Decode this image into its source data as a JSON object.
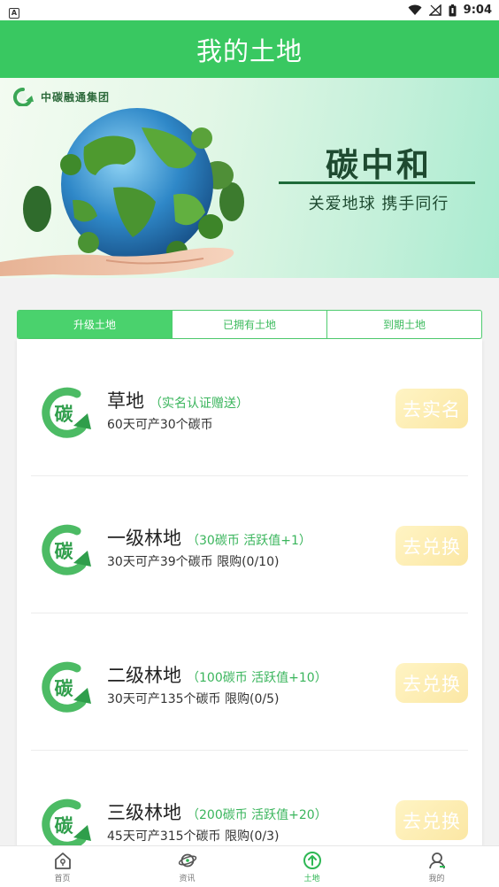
{
  "status_bar": {
    "sim_icon": "A",
    "time": "9:04",
    "icons": [
      "wifi-icon",
      "signal-icon",
      "battery-icon"
    ]
  },
  "header": {
    "title": "我的土地"
  },
  "banner": {
    "brand_name": "中碳融通集团",
    "title": "碳中和",
    "slogan": "关爱地球  携手同行"
  },
  "tabs": [
    {
      "label": "升级土地",
      "active": true
    },
    {
      "label": "已拥有土地",
      "active": false
    },
    {
      "label": "到期土地",
      "active": false
    }
  ],
  "logo_char": "碳",
  "lands": [
    {
      "name": "草地",
      "note": "（实名认证赠送）",
      "desc": "60天可产30个碳币",
      "button": "去实名"
    },
    {
      "name": "一级林地",
      "note": "（30碳币 活跃值+1）",
      "desc": "30天可产39个碳币 限购(0/10)",
      "button": "去兑换"
    },
    {
      "name": "二级林地",
      "note": "（100碳币 活跃值+10）",
      "desc": "30天可产135个碳币 限购(0/5)",
      "button": "去兑换"
    },
    {
      "name": "三级林地",
      "note": "（200碳币 活跃值+20）",
      "desc": "45天可产315个碳币 限购(0/3)",
      "button": "去兑换"
    }
  ],
  "nav": [
    {
      "label": "首页",
      "icon": "home-icon",
      "active": false
    },
    {
      "label": "资讯",
      "icon": "planet-icon",
      "active": false
    },
    {
      "label": "土地",
      "icon": "upload-circle-icon",
      "active": true
    },
    {
      "label": "我的",
      "icon": "user-icon",
      "active": false
    }
  ],
  "colors": {
    "primary_green": "#39c861",
    "tab_active": "#4ad26d",
    "note_green": "#3ab55c",
    "button_gold": "#fbe7a4"
  }
}
